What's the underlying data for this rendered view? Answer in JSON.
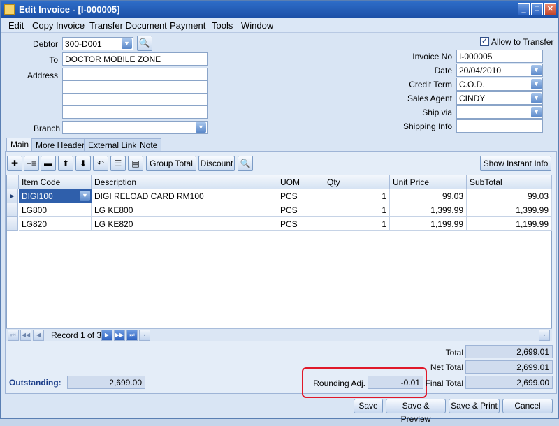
{
  "window": {
    "title": "Edit Invoice - [I-000005]",
    "minimize": "_",
    "maximize": "□",
    "close": "✕"
  },
  "menu": [
    "Edit",
    "Copy Invoice",
    "Transfer Document",
    "Payment",
    "Tools",
    "Window"
  ],
  "header": {
    "debtor_label": "Debtor",
    "debtor_value": "300-D001",
    "to_label": "To",
    "to_value": "DOCTOR MOBILE ZONE",
    "address_label": "Address",
    "address_lines": [
      "",
      "",
      "",
      ""
    ],
    "branch_label": "Branch",
    "branch_value": "",
    "allow_transfer_label": "Allow to Transfer",
    "allow_transfer_checked": "✓",
    "invoice_no_label": "Invoice No",
    "invoice_no_value": "I-000005",
    "date_label": "Date",
    "date_value": "20/04/2010",
    "credit_term_label": "Credit Term",
    "credit_term_value": "C.O.D.",
    "sales_agent_label": "Sales Agent",
    "sales_agent_value": "CINDY",
    "ship_via_label": "Ship via",
    "ship_via_value": "",
    "shipping_info_label": "Shipping Info",
    "shipping_info_value": ""
  },
  "tabs": [
    "Main",
    "More Header",
    "External Link",
    "Note"
  ],
  "toolbar": {
    "group_total": "Group Total",
    "discount": "Discount",
    "show_instant_info": "Show Instant Info"
  },
  "grid": {
    "columns": [
      "Item Code",
      "Description",
      "UOM",
      "Qty",
      "Unit Price",
      "SubTotal"
    ],
    "rows": [
      {
        "item_code": "DIGI100",
        "description": "DIGI RELOAD CARD RM100",
        "uom": "PCS",
        "qty": "1",
        "unit_price": "99.03",
        "subtotal": "99.03"
      },
      {
        "item_code": "LG800",
        "description": "LG KE800",
        "uom": "PCS",
        "qty": "1",
        "unit_price": "1,399.99",
        "subtotal": "1,399.99"
      },
      {
        "item_code": "LG820",
        "description": "LG KE820",
        "uom": "PCS",
        "qty": "1",
        "unit_price": "1,199.99",
        "subtotal": "1,199.99"
      }
    ],
    "record_text": "Record 1 of 3"
  },
  "totals": {
    "total_label": "Total",
    "total_value": "2,699.01",
    "net_total_label": "Net Total",
    "net_total_value": "2,699.01",
    "final_total_label": "Final Total",
    "final_total_value": "2,699.00",
    "rounding_label": "Rounding Adj.",
    "rounding_value": "-0.01",
    "outstanding_label": "Outstanding:",
    "outstanding_value": "2,699.00"
  },
  "buttons": {
    "save": "Save",
    "save_preview": "Save & Preview",
    "save_print": "Save & Print",
    "cancel": "Cancel"
  },
  "colors": {
    "title_bar": "#1b4fa6",
    "highlight": "#e0192a",
    "outstanding": "#1d3f8a"
  }
}
